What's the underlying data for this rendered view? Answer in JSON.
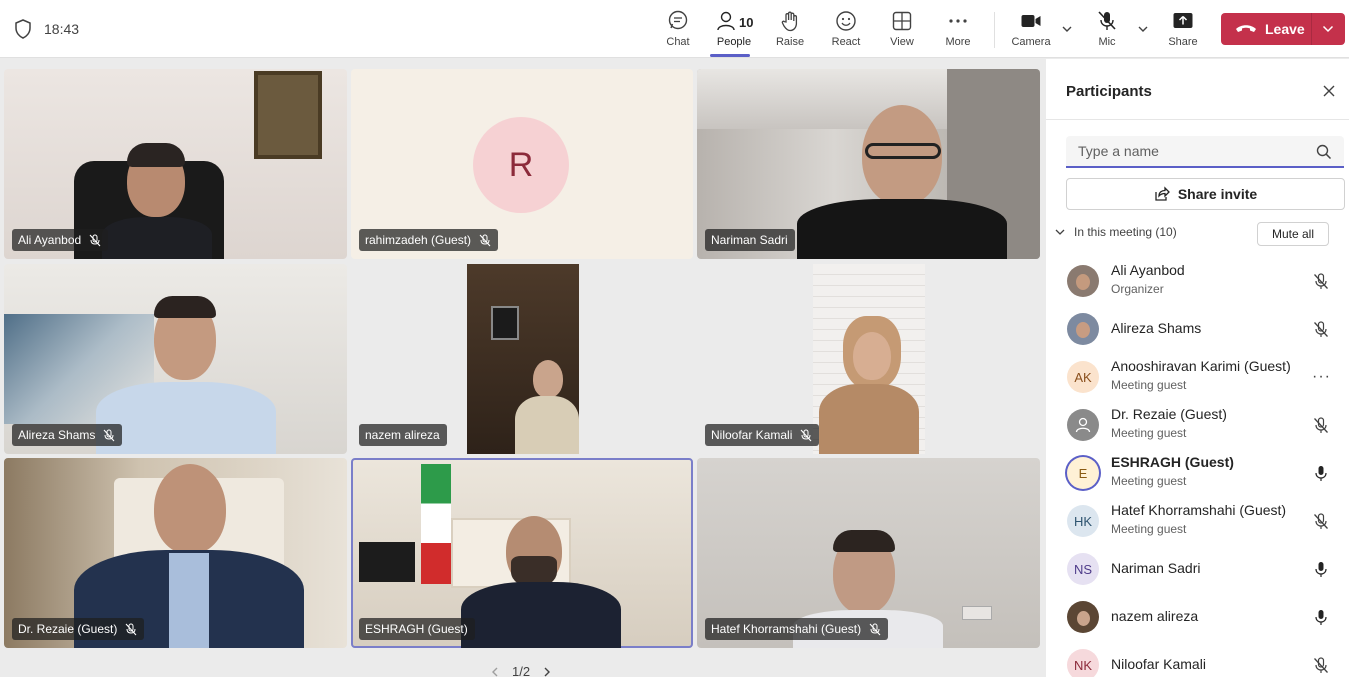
{
  "status": {
    "time": "18:43"
  },
  "toolbar": {
    "chat": "Chat",
    "people": "People",
    "people_count": "10",
    "raise": "Raise",
    "react": "React",
    "view": "View",
    "more": "More",
    "camera": "Camera",
    "mic": "Mic",
    "share": "Share",
    "leave": "Leave"
  },
  "grid": {
    "tiles": [
      {
        "name": "Ali Ayanbod"
      },
      {
        "name": "rahimzadeh (Guest)",
        "initial": "R"
      },
      {
        "name": "Nariman Sadri"
      },
      {
        "name": "Alireza Shams"
      },
      {
        "name": "nazem alireza"
      },
      {
        "name": "Niloofar Kamali"
      },
      {
        "name": "Dr. Rezaie (Guest)"
      },
      {
        "name": "ESHRAGH (Guest)"
      },
      {
        "name": "Hatef Khorramshahi (Guest)"
      }
    ],
    "page": "1/2"
  },
  "panel": {
    "title": "Participants",
    "search_placeholder": "Type a name",
    "share_invite": "Share invite",
    "section": "In this meeting (10)",
    "mute_all": "Mute all",
    "participants": [
      {
        "name": "Ali Ayanbod",
        "sub": "Organizer",
        "mic": "muted"
      },
      {
        "name": "Alireza Shams",
        "sub": "",
        "mic": "muted"
      },
      {
        "name": "Anooshiravan Karimi (Guest)",
        "sub": "Meeting guest",
        "initials": "AK",
        "mic": "more"
      },
      {
        "name": "Dr. Rezaie (Guest)",
        "sub": "Meeting guest",
        "mic": "muted"
      },
      {
        "name": "ESHRAGH (Guest)",
        "sub": "Meeting guest",
        "initials": "E",
        "mic": "on"
      },
      {
        "name": "Hatef Khorramshahi (Guest)",
        "sub": "Meeting guest",
        "initials": "HK",
        "mic": "muted"
      },
      {
        "name": "Nariman Sadri",
        "sub": "",
        "initials": "NS",
        "mic": "on"
      },
      {
        "name": "nazem alireza",
        "sub": "",
        "mic": "on"
      },
      {
        "name": "Niloofar Kamali",
        "sub": "",
        "initials": "NK",
        "mic": "muted"
      }
    ]
  },
  "colors": {
    "accent": "#5b5fc7",
    "leave": "#c4314b"
  }
}
